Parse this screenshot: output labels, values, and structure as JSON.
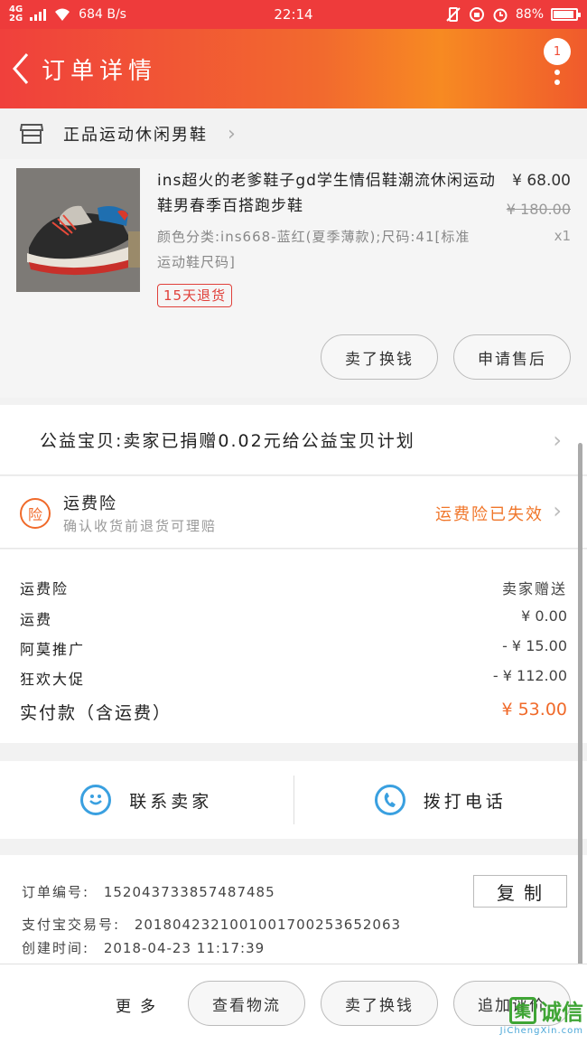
{
  "status_bar": {
    "network_top": "4G",
    "network_bottom": "2G",
    "speed": "684 B/s",
    "time": "22:14",
    "battery": "88%"
  },
  "header": {
    "title": "订单详情",
    "badge": "1"
  },
  "shop": {
    "name": "正品运动休闲男鞋"
  },
  "product": {
    "title": "ins超火的老爹鞋子gd学生情侣鞋潮流休闲运动鞋男春季百搭跑步鞋",
    "spec": "颜色分类:ins668-蓝红(夏季薄款);尺码:41[标准运动鞋尺码]",
    "price": "¥ 68.00",
    "original_price": "¥ 180.00",
    "quantity": "x1",
    "tag": "15天退货",
    "buy_again_label": "卖了换钱",
    "after_sale_label": "申请售后"
  },
  "charity": {
    "text": "公益宝贝:卖家已捐赠0.02元给公益宝贝计划"
  },
  "insurance": {
    "icon_text": "险",
    "title": "运费险",
    "subtitle": "确认收货前退货可理赔",
    "status": "运费险已失效"
  },
  "totals": {
    "rows": [
      {
        "label": "运费险",
        "value": "卖家赠送"
      },
      {
        "label": "运费",
        "value": "¥ 0.00"
      },
      {
        "label": "阿莫推广",
        "value": "- ¥ 15.00"
      },
      {
        "label": "狂欢大促",
        "value": "- ¥ 112.00"
      }
    ],
    "paid_label": "实付款（含运费）",
    "paid_value": "¥ 53.00"
  },
  "contact": {
    "seller_label": "联系卖家",
    "call_label": "拨打电话"
  },
  "order_info": {
    "order_no_label": "订单编号:",
    "order_no": "152043733857487485",
    "alipay_label": "支付宝交易号:",
    "alipay_no": "2018042321001001700253652063",
    "created_label": "创建时间:",
    "created_time": "2018-04-23 11:17:39",
    "copy_label": "复制"
  },
  "bottom_bar": {
    "more_label": "更多",
    "logistics_label": "查看物流",
    "sell_label": "卖了换钱",
    "review_label": "追加评价"
  },
  "watermark": {
    "box_char": "集",
    "main": "诚信",
    "sub": "JiChengXin.com"
  },
  "colors": {
    "header_start": "#f0403c",
    "header_end": "#f78a22",
    "accent_orange": "#f06a2a",
    "return_tag_red": "#e0403a",
    "contact_blue": "#3aa0e0"
  }
}
